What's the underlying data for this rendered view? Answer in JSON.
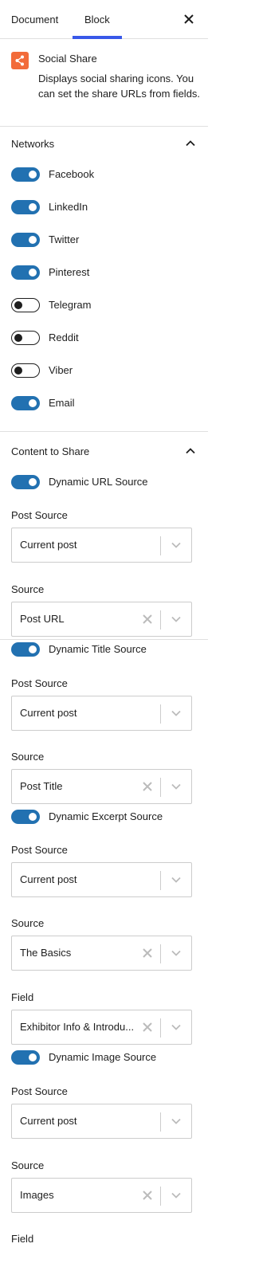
{
  "tabs": {
    "document": "Document",
    "block": "Block",
    "close": "×"
  },
  "block": {
    "title": "Social Share",
    "description": "Displays social sharing icons. You can set the share URLs from fields."
  },
  "networks": {
    "title": "Networks",
    "items": [
      {
        "label": "Facebook",
        "enabled": true
      },
      {
        "label": "LinkedIn",
        "enabled": true
      },
      {
        "label": "Twitter",
        "enabled": true
      },
      {
        "label": "Pinterest",
        "enabled": true
      },
      {
        "label": "Telegram",
        "enabled": false
      },
      {
        "label": "Reddit",
        "enabled": false
      },
      {
        "label": "Viber",
        "enabled": false
      },
      {
        "label": "Email",
        "enabled": true
      }
    ]
  },
  "content": {
    "title": "Content to Share",
    "url": {
      "toggle": "Dynamic URL Source",
      "post_source_label": "Post Source",
      "post_source_value": "Current post",
      "source_label": "Source",
      "source_value": "Post URL"
    },
    "title_src": {
      "toggle": "Dynamic Title Source",
      "post_source_label": "Post Source",
      "post_source_value": "Current post",
      "source_label": "Source",
      "source_value": "Post Title"
    },
    "excerpt": {
      "toggle": "Dynamic Excerpt Source",
      "post_source_label": "Post Source",
      "post_source_value": "Current post",
      "source_label": "Source",
      "source_value": "The Basics",
      "field_label": "Field",
      "field_value": "Exhibitor Info & Introdu..."
    },
    "image": {
      "toggle": "Dynamic Image Source",
      "post_source_label": "Post Source",
      "post_source_value": "Current post",
      "source_label": "Source",
      "source_value": "Images",
      "field_label": "Field"
    }
  },
  "colors": {
    "accent": "#2271b1",
    "tab_indicator": "#3858e9",
    "block_icon": "#f26b3a"
  }
}
